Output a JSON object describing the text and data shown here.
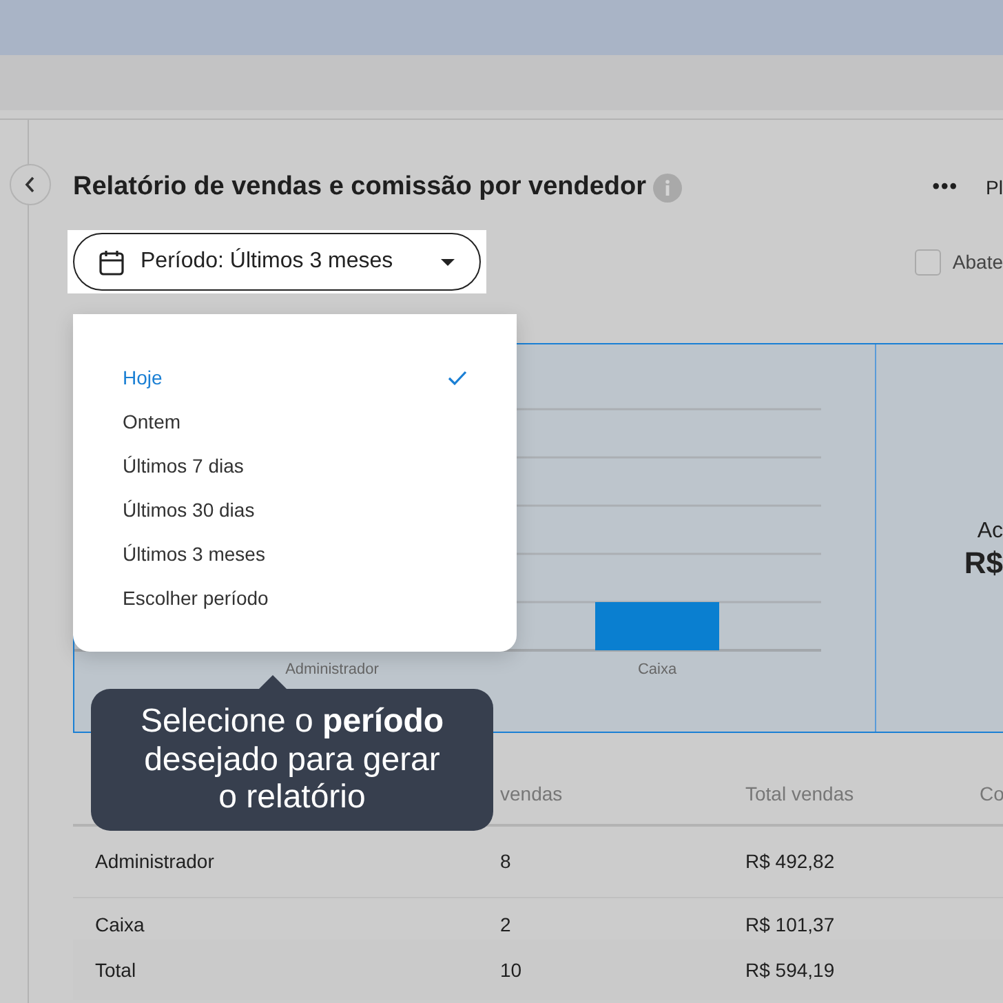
{
  "header": {
    "title": "Relatório de vendas e comissão por vendedor",
    "more_button": "•••",
    "cut_button": "Pl"
  },
  "period_button": {
    "label": "Período: Últimos 3 meses"
  },
  "deduct_checkbox": {
    "label": "Abate",
    "checked": false
  },
  "period_menu": [
    {
      "label": "Hoje",
      "selected": true
    },
    {
      "label": "Ontem",
      "selected": false
    },
    {
      "label": "Últimos 7 dias",
      "selected": false
    },
    {
      "label": "Últimos 30 dias",
      "selected": false
    },
    {
      "label": "Últimos 3 meses",
      "selected": false
    },
    {
      "label": "Escolher período",
      "selected": false
    }
  ],
  "chart": {
    "categories": [
      "Administrador",
      "Caixa"
    ]
  },
  "summary": {
    "label": "Ac",
    "value": "R$"
  },
  "tooltip": {
    "text": "Selecione o **período** desejado para gerar o relatório"
  },
  "table": {
    "columns": [
      "",
      "vendas",
      "Total vendas",
      "Co"
    ],
    "rows": [
      [
        "Administrador",
        "8",
        "R$ 492,82"
      ],
      [
        "Caixa",
        "2",
        "R$ 101,37"
      ]
    ],
    "total": [
      "Total",
      "10",
      "R$ 594,19"
    ]
  }
}
